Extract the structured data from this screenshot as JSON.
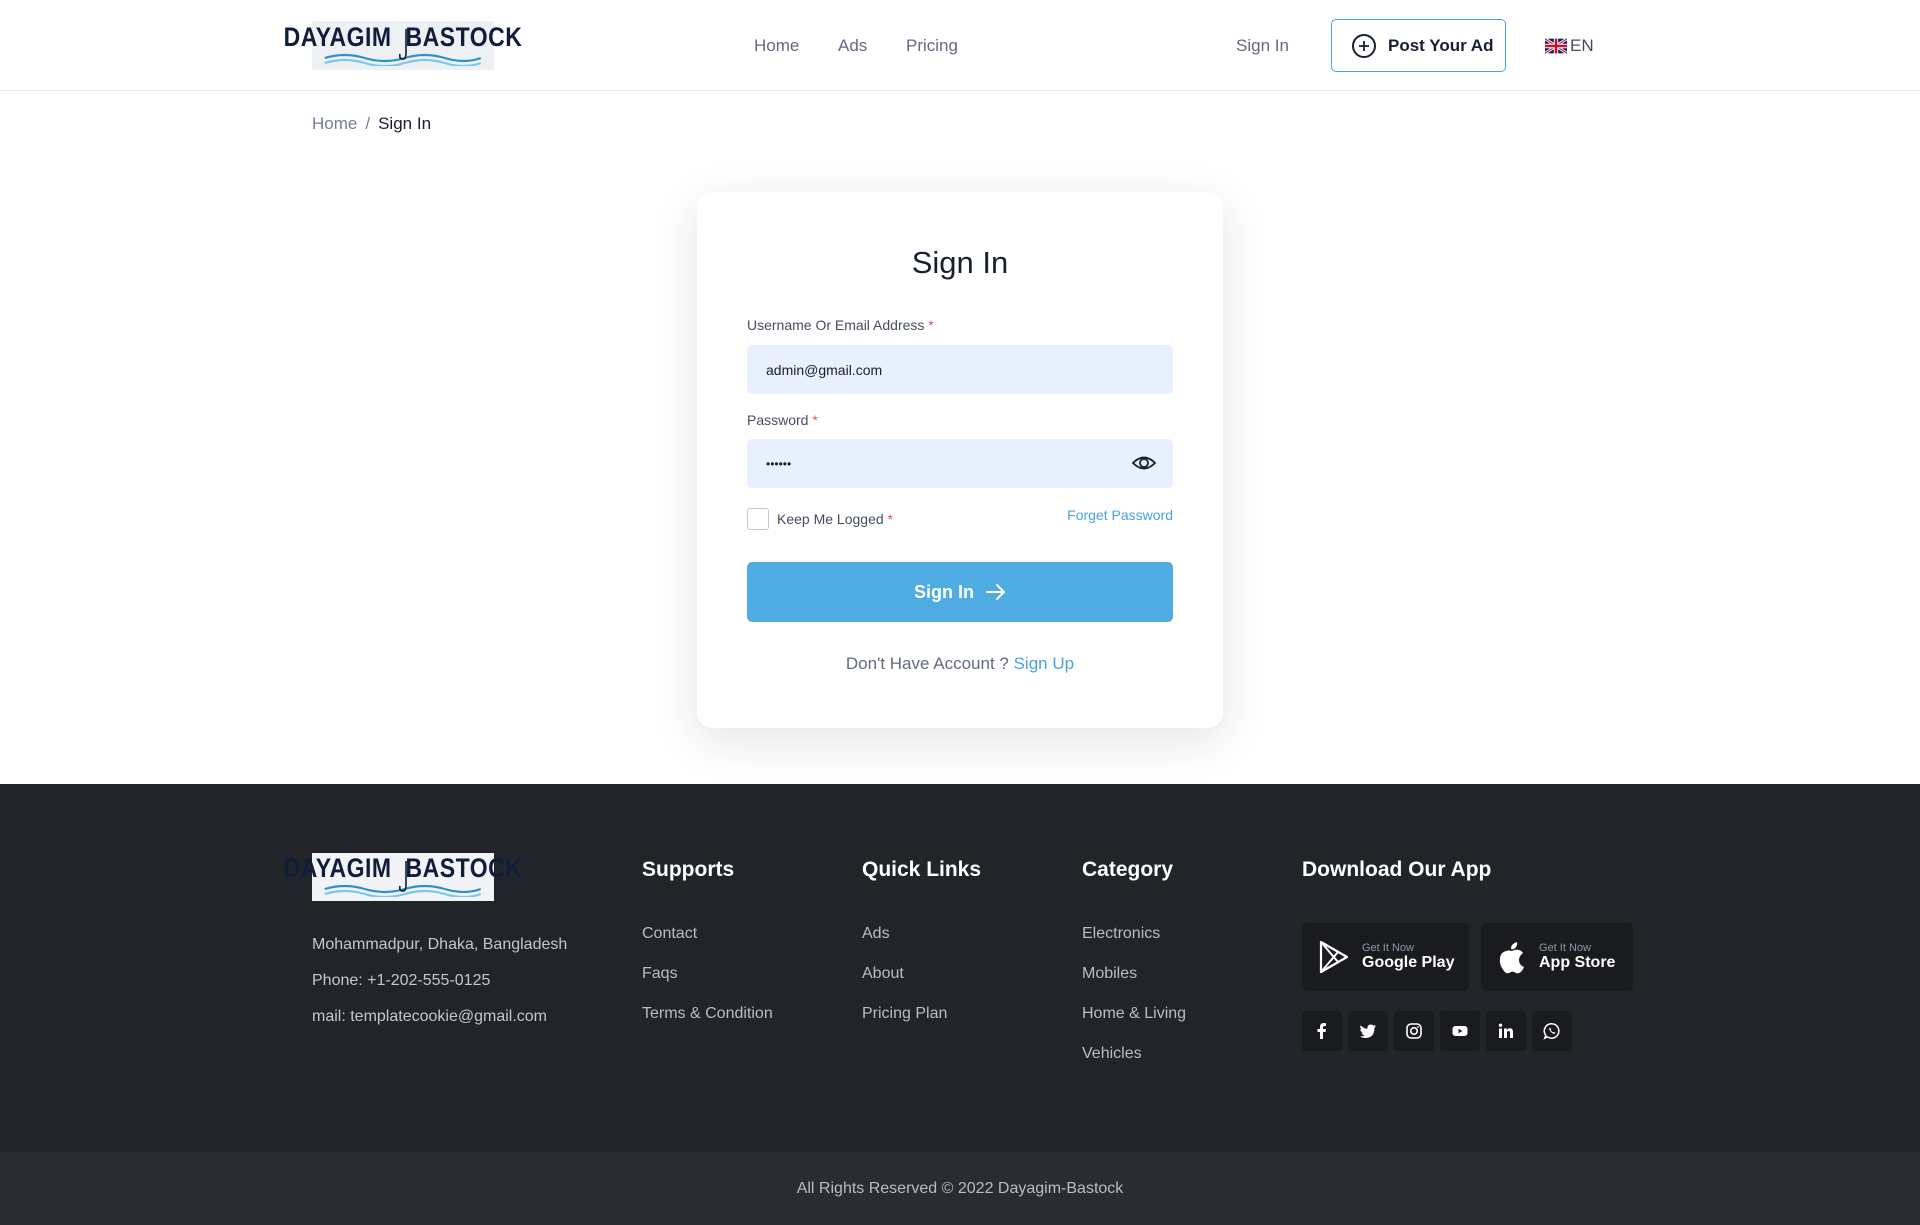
{
  "brand": {
    "logo_text_left": "DAYAGIM",
    "logo_text_right": "BASTOCK"
  },
  "header": {
    "nav": [
      {
        "label": "Home"
      },
      {
        "label": "Ads"
      },
      {
        "label": "Pricing"
      }
    ],
    "sign_in_label": "Sign In",
    "post_ad_label": "Post Your Ad",
    "language": "EN"
  },
  "breadcrumb": {
    "home": "Home",
    "separator": "/",
    "current": "Sign In"
  },
  "signin_form": {
    "title": "Sign In",
    "username_label": "Username Or Email Address",
    "username_value": "admin@gmail.com",
    "password_label": "Password",
    "password_value": "••••••",
    "required_marker": "*",
    "keep_logged_label": "Keep Me Logged",
    "forget_password": "Forget Password",
    "submit_label": "Sign In",
    "no_account_text": "Don't Have Account ?",
    "signup_link": "Sign Up"
  },
  "footer": {
    "address": "Mohammadpur, Dhaka, Bangladesh",
    "phone": "Phone: +1-202-555-0125",
    "mail": "mail: templatecookie@gmail.com",
    "supports": {
      "title": "Supports",
      "links": [
        "Contact",
        "Faqs",
        "Terms & Condition"
      ]
    },
    "quick_links": {
      "title": "Quick Links",
      "links": [
        "Ads",
        "About",
        "Pricing Plan"
      ]
    },
    "category": {
      "title": "Category",
      "links": [
        "Electronics",
        "Mobiles",
        "Home & Living",
        "Vehicles"
      ]
    },
    "download": {
      "title": "Download Our App",
      "google_small": "Get It Now",
      "google_big": "Google Play",
      "apple_small": "Get It Now",
      "apple_big": "App Store"
    },
    "social_icons": [
      "facebook-icon",
      "twitter-icon",
      "instagram-icon",
      "youtube-icon",
      "linkedin-icon",
      "whatsapp-icon"
    ],
    "copyright": "All Rights Reserved © 2022 Dayagim-Bastock"
  },
  "colors": {
    "accent": "#4eace3",
    "link": "#4aa3e0",
    "footer_bg": "#212429",
    "input_bg": "#e8f0fe"
  }
}
